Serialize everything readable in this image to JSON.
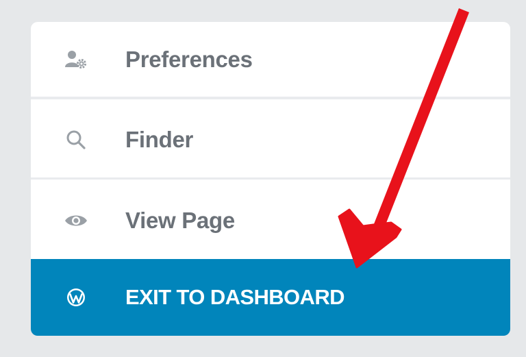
{
  "menu": {
    "items": [
      {
        "label": "Preferences",
        "icon": "user-gear-icon"
      },
      {
        "label": "Finder",
        "icon": "search-icon"
      },
      {
        "label": "View Page",
        "icon": "eye-icon"
      },
      {
        "label": "EXIT TO DASHBOARD",
        "icon": "wordpress-icon"
      }
    ]
  },
  "colors": {
    "page_background": "#e6e8ea",
    "panel_background": "#ffffff",
    "item_text": "#6b7178",
    "icon_gray": "#9aa0a6",
    "divider": "#e9ebee",
    "active_background": "#0185bb",
    "active_text": "#ffffff",
    "annotation_arrow": "#e8121b"
  }
}
